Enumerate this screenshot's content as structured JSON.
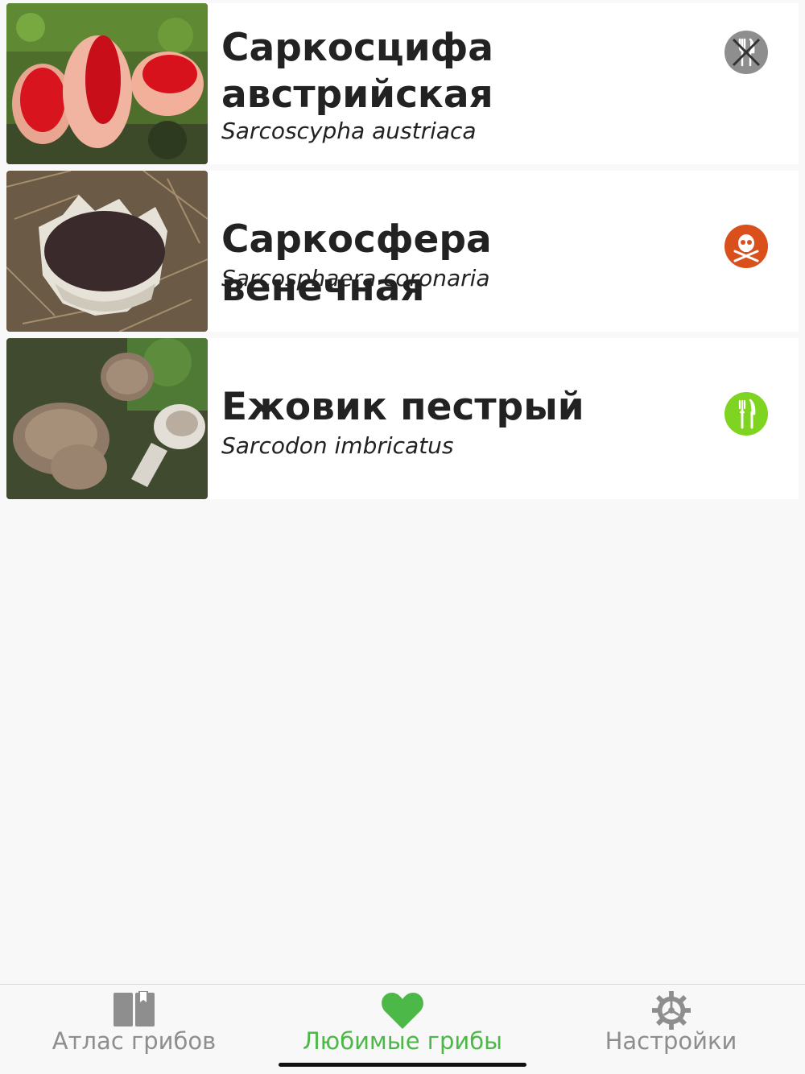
{
  "mushrooms": [
    {
      "title_line1": "Саркосцифа",
      "title_line2": "австрийская",
      "latin": "Sarcoscypha austriaca",
      "edibility_icon": "inedible-icon",
      "edibility_color": "#8e8e8e"
    },
    {
      "title_line1": "Саркосфера венечная",
      "title_line2": "",
      "latin": "Sarcosphaera coronaria",
      "edibility_icon": "poisonous-icon",
      "edibility_color": "#d9501d"
    },
    {
      "title_line1": "Ежовик пестрый",
      "title_line2": "",
      "latin": "Sarcodon imbricatus",
      "edibility_icon": "edible-icon",
      "edibility_color": "#7fd321"
    }
  ],
  "tabbar": {
    "tabs": [
      {
        "label": "Атлас грибов",
        "icon": "book-icon",
        "active": false
      },
      {
        "label": "Любимые грибы",
        "icon": "heart-icon",
        "active": true
      },
      {
        "label": "Настройки",
        "icon": "gear-icon",
        "active": false
      }
    ],
    "active_color": "#4cb847",
    "inactive_color": "#8e8e8e"
  }
}
